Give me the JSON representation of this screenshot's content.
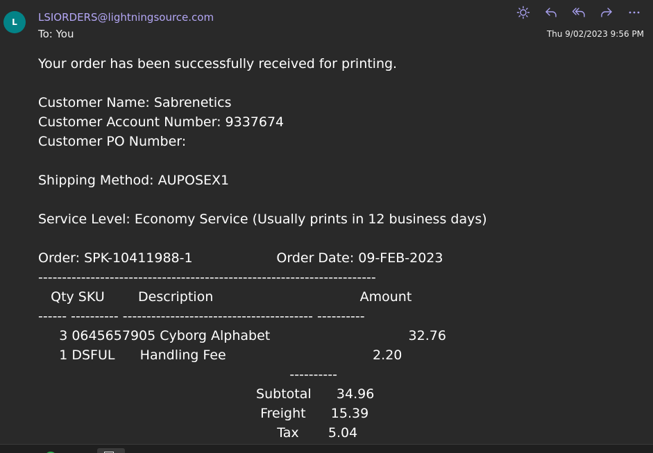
{
  "header": {
    "avatar_initial": "L",
    "sender": "LSIORDERS@lightningsource.com",
    "to_line": "To:  You",
    "timestamp": "Thu 9/02/2023 9:56 PM",
    "actions": [
      "sun-icon",
      "reply-icon",
      "reply-all-icon",
      "forward-icon",
      "more-icon"
    ]
  },
  "colors": {
    "avatar": "#038387",
    "sender": "#b4a7f5",
    "background": "#292929",
    "icons": "#a9a1f0"
  },
  "email_body": "Your order has been successfully received for printing.\n\nCustomer Name: Sabrenetics\nCustomer Account Number: 9337674\nCustomer PO Number:\n\nShipping Method: AUPOSEX1\n\nService Level: Economy Service (Usually prints in 12 business days)\n\nOrder: SPK-10411988-1                    Order Date: 09-FEB-2023\n-----------------------------------------------------------------------\n   Qty SKU        Description                                   Amount\n------ ---------- ---------------------------------------- ----------\n     3 0645657905 Cyborg Alphabet                                 32.76\n     1 DSFUL      Handling Fee                                   2.20\n                                                            ----------\n                                                    Subtotal      34.96\n                                                     Freight      15.39\n                                                         Tax       5.04"
}
